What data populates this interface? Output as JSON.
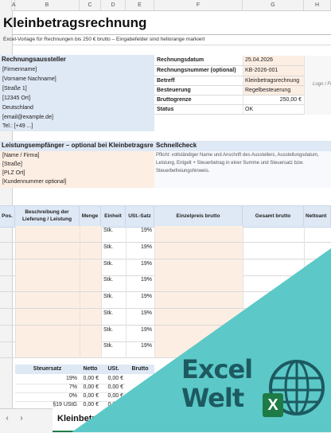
{
  "columns": [
    "A",
    "B",
    "C",
    "D",
    "E",
    "F",
    "G",
    "H"
  ],
  "title": "Kleinbetragsrechnung",
  "subtitle": "Excel-Vorlage für Rechnungen bis 250 € brutto – Eingabefelder sind hellorange markiert",
  "issuer": {
    "header": "Rechnungsaussteller",
    "lines": [
      "[Firmenname]",
      "[Vorname Nachname]",
      "[Straße 1]",
      "[12345 Ort]",
      "Deutschland",
      "[email@example.de]",
      "Tel.: [+49 ...]"
    ]
  },
  "meta": [
    {
      "label": "Rechnungsdatum",
      "value": "25.04.2026"
    },
    {
      "label": "Rechnungsnummer (optional)",
      "value": "KB-2026-001"
    },
    {
      "label": "Betreff",
      "value": "Kleinbetragsrechnung"
    },
    {
      "label": "Besteuerung",
      "value": "Regelbesteuerung"
    },
    {
      "label": "Bruttogrenze",
      "value": "250,00 €"
    },
    {
      "label": "Status",
      "value": "OK"
    }
  ],
  "logo_placeholder": "Logo / Fi",
  "recipient": {
    "header": "Leistungsempfänger – optional bei Kleinbetragsre",
    "lines": [
      "[Name / Firma]",
      "[Straße]",
      "[PLZ Ort]",
      "[Kundennummer optional]"
    ]
  },
  "quickcheck": {
    "header": "Schnellcheck",
    "lines": [
      "Pflicht: vollständiger Name und Anschrift des Ausstellers, Ausstellungsdatum,",
      "Leistung, Entgelt + Steuerbetrag in einer Summe und Steuersatz bzw.",
      "Steuerbefreiungshinweis."
    ]
  },
  "items_table": {
    "headers": {
      "pos": "Pos.",
      "desc1": "Beschreibung der",
      "desc2": "Lieferung / Leistung",
      "qty": "Menge",
      "unit": "Einheit",
      "vat": "USt.-Satz",
      "unit_price": "Einzelpreis brutto",
      "total": "Gesamt brutto",
      "net": "Nettoant"
    },
    "rows": [
      {
        "unit": "Stk.",
        "vat": "19%"
      },
      {
        "unit": "Stk.",
        "vat": "19%"
      },
      {
        "unit": "Stk.",
        "vat": "19%"
      },
      {
        "unit": "Stk.",
        "vat": "19%"
      },
      {
        "unit": "Stk.",
        "vat": "19%"
      },
      {
        "unit": "Stk.",
        "vat": "19%"
      },
      {
        "unit": "Stk.",
        "vat": "19%"
      },
      {
        "unit": "Stk.",
        "vat": "19%"
      }
    ]
  },
  "tax_summary": {
    "headers": {
      "rate": "Steuersatz",
      "net": "Netto",
      "vat": "USt.",
      "gross": "Brutto"
    },
    "rows": [
      {
        "rate": "19%",
        "net": "0,00 €",
        "vat": "0,00 €"
      },
      {
        "rate": "7%",
        "net": "0,00 €",
        "vat": "0,00 €"
      },
      {
        "rate": "0%",
        "net": "0,00 €",
        "vat": "0,00 €"
      },
      {
        "rate": "§19 UStG",
        "net": "0,00 €",
        "vat": "0,00 €"
      }
    ]
  },
  "sheet_tab": "Kleinbetra",
  "brand": {
    "line1": "Excel",
    "line2": "Welt",
    "badge": "X"
  },
  "colors": {
    "section_blue": "#dfe8f5",
    "input_peach": "#fdeee3",
    "teal": "#5cc8c8",
    "brand_dark": "#1c5a60",
    "excel_green": "#1e7b45"
  }
}
